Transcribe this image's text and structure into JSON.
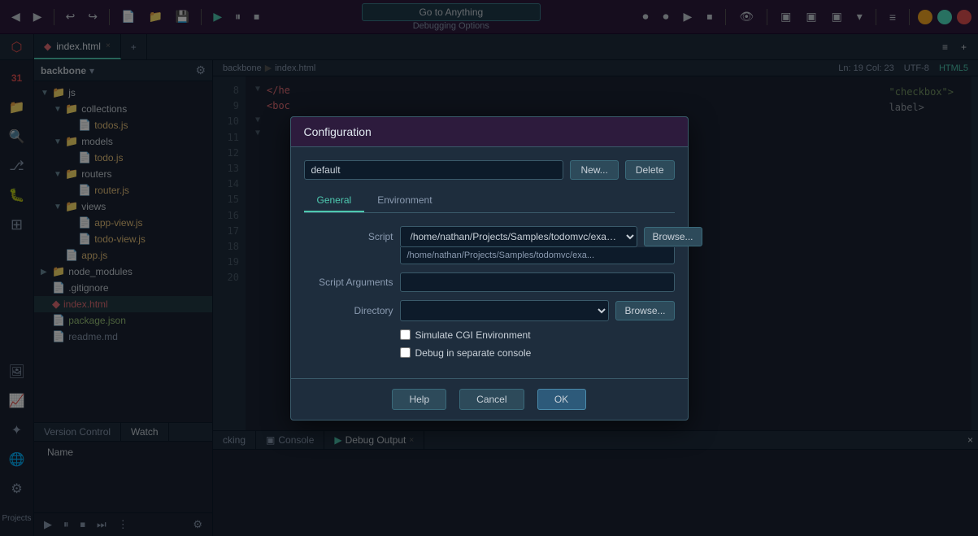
{
  "app": {
    "title": "Go to Anything",
    "subtitle": "Debugging Options"
  },
  "toolbar": {
    "back": "◀",
    "forward": "▶",
    "undo": "↩",
    "redo": "↪",
    "open_file": "📄",
    "open_folder": "📁",
    "save": "💾",
    "run": "▶",
    "pause": "⏸",
    "stop": "⏹",
    "record_btn": "⏺",
    "info_icon": "ℹ",
    "eye_icon": "👁",
    "layout1": "▣",
    "layout2": "▣",
    "layout3": "▣",
    "menu": "≡",
    "minimize": "–",
    "maximize": "+",
    "close": "×"
  },
  "tabs": [
    {
      "label": "index.html",
      "active": true,
      "type": "html",
      "closable": true
    },
    {
      "label": "+",
      "active": false,
      "type": "add",
      "closable": false
    }
  ],
  "file_tree": {
    "project_name": "backbone",
    "items": [
      {
        "label": "js",
        "type": "folder",
        "indent": 0,
        "expanded": true
      },
      {
        "label": "collections",
        "type": "folder",
        "indent": 1,
        "expanded": true
      },
      {
        "label": "todos.js",
        "type": "js",
        "indent": 2,
        "expanded": false
      },
      {
        "label": "models",
        "type": "folder",
        "indent": 1,
        "expanded": true
      },
      {
        "label": "todo.js",
        "type": "js",
        "indent": 2,
        "expanded": false
      },
      {
        "label": "routers",
        "type": "folder",
        "indent": 1,
        "expanded": true
      },
      {
        "label": "router.js",
        "type": "js",
        "indent": 2,
        "expanded": false
      },
      {
        "label": "views",
        "type": "folder",
        "indent": 1,
        "expanded": true
      },
      {
        "label": "app-view.js",
        "type": "js",
        "indent": 2,
        "expanded": false
      },
      {
        "label": "todo-view.js",
        "type": "js",
        "indent": 2,
        "expanded": false
      },
      {
        "label": "app.js",
        "type": "js",
        "indent": 1,
        "expanded": false
      },
      {
        "label": "node_modules",
        "type": "folder",
        "indent": 0,
        "expanded": false
      },
      {
        "label": ".gitignore",
        "type": "file",
        "indent": 0,
        "expanded": false
      },
      {
        "label": "index.html",
        "type": "html",
        "indent": 0,
        "expanded": false
      },
      {
        "label": "package.json",
        "type": "json",
        "indent": 0,
        "expanded": false
      },
      {
        "label": "readme.md",
        "type": "md",
        "indent": 0,
        "expanded": false
      }
    ]
  },
  "breadcrumb": {
    "path": [
      "backbone",
      "▶",
      "index.html"
    ],
    "position": "Ln: 19 Col: 23",
    "encoding": "UTF-8",
    "lang": "HTML5"
  },
  "code": {
    "lines": [
      {
        "num": 8,
        "fold": "▼",
        "text": "  </he"
      },
      {
        "num": 9,
        "fold": " ",
        "text": "  <boc"
      },
      {
        "num": 10,
        "fold": " ",
        "text": ""
      },
      {
        "num": 11,
        "fold": "▼",
        "text": ""
      },
      {
        "num": 12,
        "fold": " ",
        "text": ""
      },
      {
        "num": 13,
        "fold": " ",
        "text": ""
      },
      {
        "num": 14,
        "fold": " ",
        "text": ""
      },
      {
        "num": 15,
        "fold": "▼",
        "text": ""
      },
      {
        "num": 16,
        "fold": " ",
        "text": ""
      },
      {
        "num": 17,
        "fold": " ",
        "text": ""
      },
      {
        "num": 18,
        "fold": " ",
        "text": ""
      },
      {
        "num": 19,
        "fold": " ",
        "text": ""
      },
      {
        "num": 20,
        "fold": " ",
        "text": ""
      }
    ]
  },
  "bottom_panel": {
    "tabs": [
      {
        "label": "Version Control",
        "active": false
      },
      {
        "label": "Watch",
        "active": true
      }
    ],
    "watch": {
      "col_name": "Name",
      "toolbar_buttons": [
        "▶",
        "⏸",
        "⏹",
        "⏭",
        "⋮"
      ]
    }
  },
  "output_panel": {
    "tabs": [
      {
        "label": "cking",
        "active": false,
        "closable": false
      },
      {
        "label": "Console",
        "active": false,
        "closable": false,
        "icon": "▣"
      },
      {
        "label": "Debug Output",
        "active": true,
        "closable": true,
        "icon": "▶"
      }
    ]
  },
  "modal": {
    "title": "Configuration",
    "config_label": "default",
    "config_placeholder": "default",
    "btn_new": "New...",
    "btn_delete": "Delete",
    "tabs": [
      {
        "label": "General",
        "active": true
      },
      {
        "label": "Environment",
        "active": false
      }
    ],
    "script_label": "Script",
    "script_value": "/home/nathan/Projects/Samples/todomvc/exa…",
    "script_dropdown_value": "/home/nathan/Projects/Samples/todomvc/exa...",
    "btn_browse_script": "Browse...",
    "script_args_label": "Script Arguments",
    "script_args_value": "",
    "directory_label": "Directory",
    "directory_value": "",
    "btn_browse_dir": "Browse...",
    "simulate_cgi_label": "Simulate CGI Environment",
    "simulate_cgi_checked": false,
    "debug_separate_label": "Debug in separate console",
    "debug_separate_checked": false,
    "footer_help": "Help",
    "footer_cancel": "Cancel",
    "footer_ok": "OK"
  }
}
